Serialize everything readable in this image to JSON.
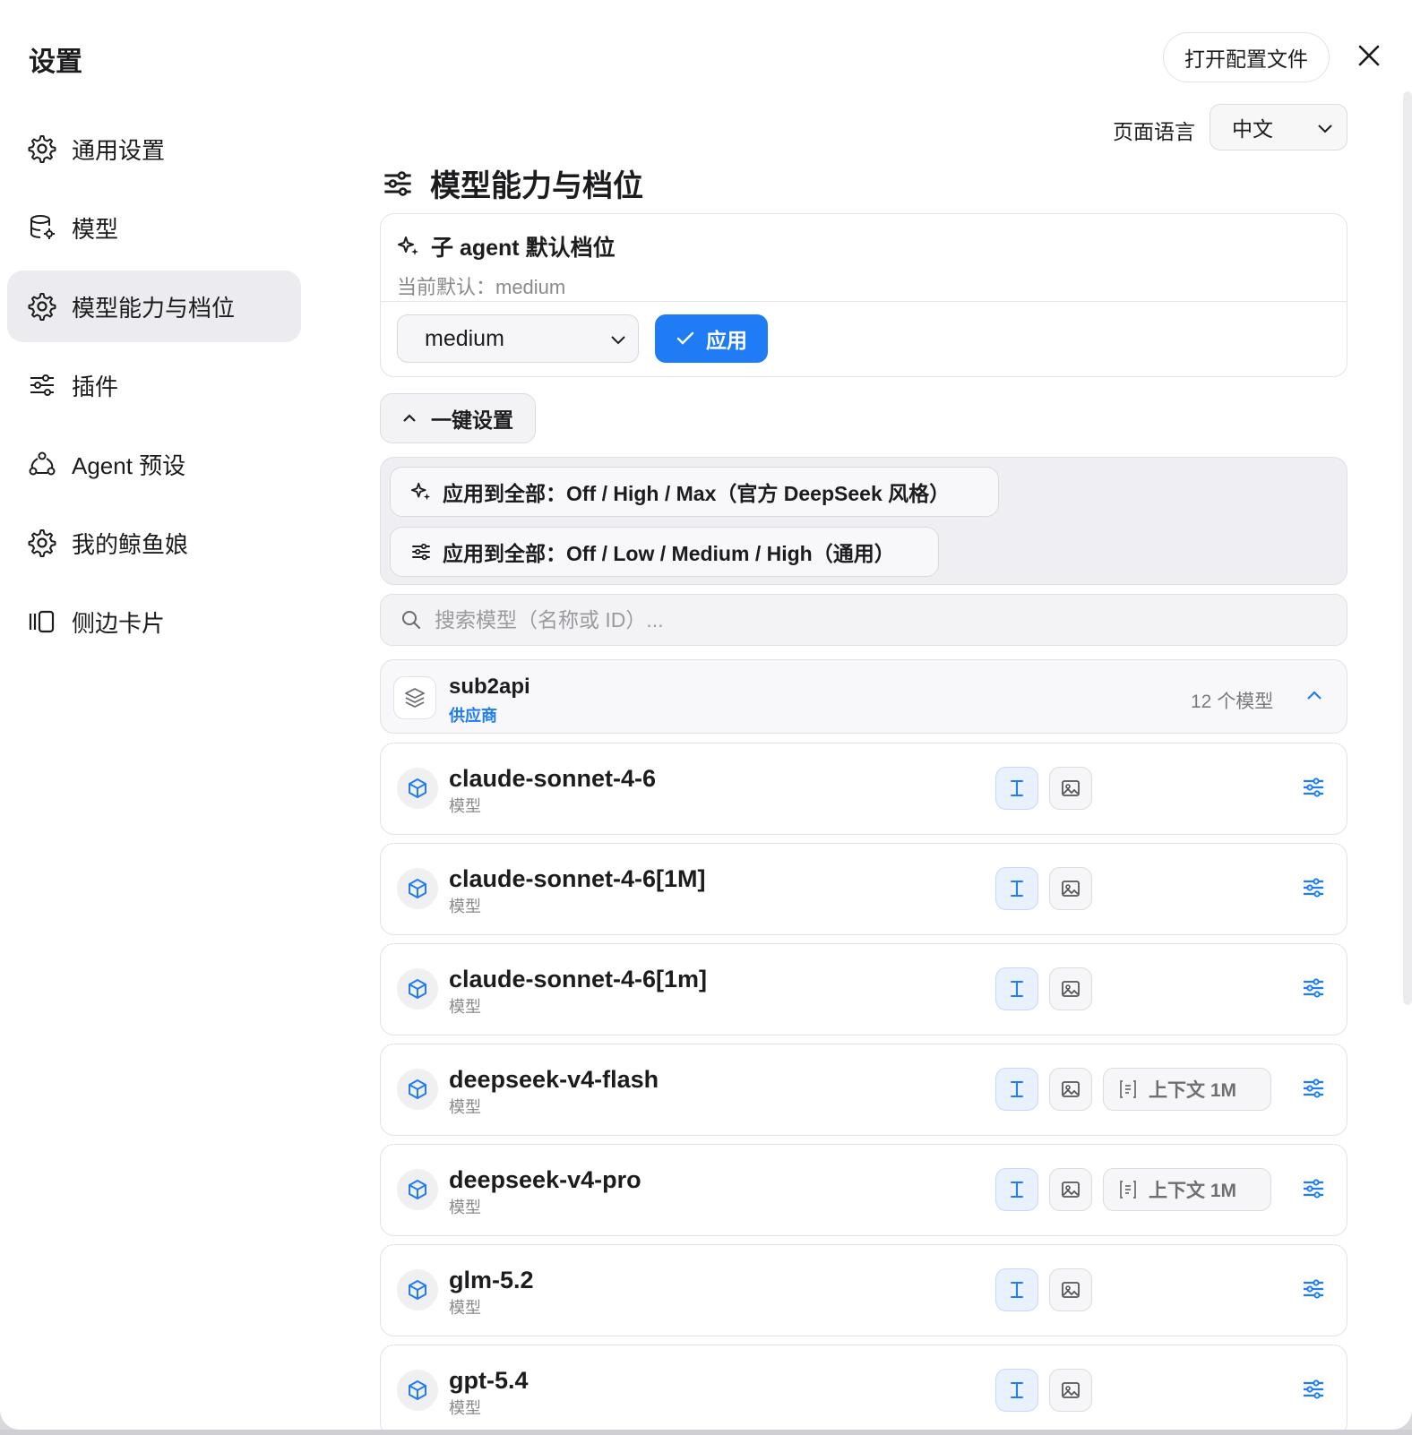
{
  "dialog": {
    "title": "设置",
    "open_config_label": "打开配置文件"
  },
  "sidebar": {
    "items": [
      {
        "label": "通用设置",
        "icon": "gear-icon"
      },
      {
        "label": "模型",
        "icon": "database-gear-icon"
      },
      {
        "label": "模型能力与档位",
        "icon": "gear-icon",
        "active": true
      },
      {
        "label": "插件",
        "icon": "sliders-icon"
      },
      {
        "label": "Agent 预设",
        "icon": "agent-nodes-icon"
      },
      {
        "label": "我的鲸鱼娘",
        "icon": "gear-icon"
      },
      {
        "label": "侧边卡片",
        "icon": "side-cards-icon"
      }
    ]
  },
  "language": {
    "label": "页面语言",
    "selected": "中文"
  },
  "section": {
    "title": "模型能力与档位"
  },
  "agent_default": {
    "title": "子 agent 默认档位",
    "current": "当前默认：medium",
    "select_value": "medium",
    "apply_label": "应用"
  },
  "quick_setup": {
    "label": "一键设置",
    "presets": [
      "应用到全部：Off / High / Max（官方 DeepSeek 风格）",
      "应用到全部：Off / Low / Medium / High（通用）"
    ]
  },
  "search": {
    "placeholder": "搜索模型（名称或 ID）..."
  },
  "provider": {
    "name": "sub2api",
    "type": "供应商",
    "count": "12 个模型"
  },
  "models": [
    {
      "name": "claude-sonnet-4-6",
      "type": "模型",
      "context": null
    },
    {
      "name": "claude-sonnet-4-6[1M]",
      "type": "模型",
      "context": null
    },
    {
      "name": "claude-sonnet-4-6[1m]",
      "type": "模型",
      "context": null
    },
    {
      "name": "deepseek-v4-flash",
      "type": "模型",
      "context": "上下文 1M"
    },
    {
      "name": "deepseek-v4-pro",
      "type": "模型",
      "context": "上下文 1M"
    },
    {
      "name": "glm-5.2",
      "type": "模型",
      "context": null
    },
    {
      "name": "gpt-5.4",
      "type": "模型",
      "context": null
    }
  ],
  "colors": {
    "accent": "#1f7cf5",
    "active_bg": "#ececf0"
  }
}
